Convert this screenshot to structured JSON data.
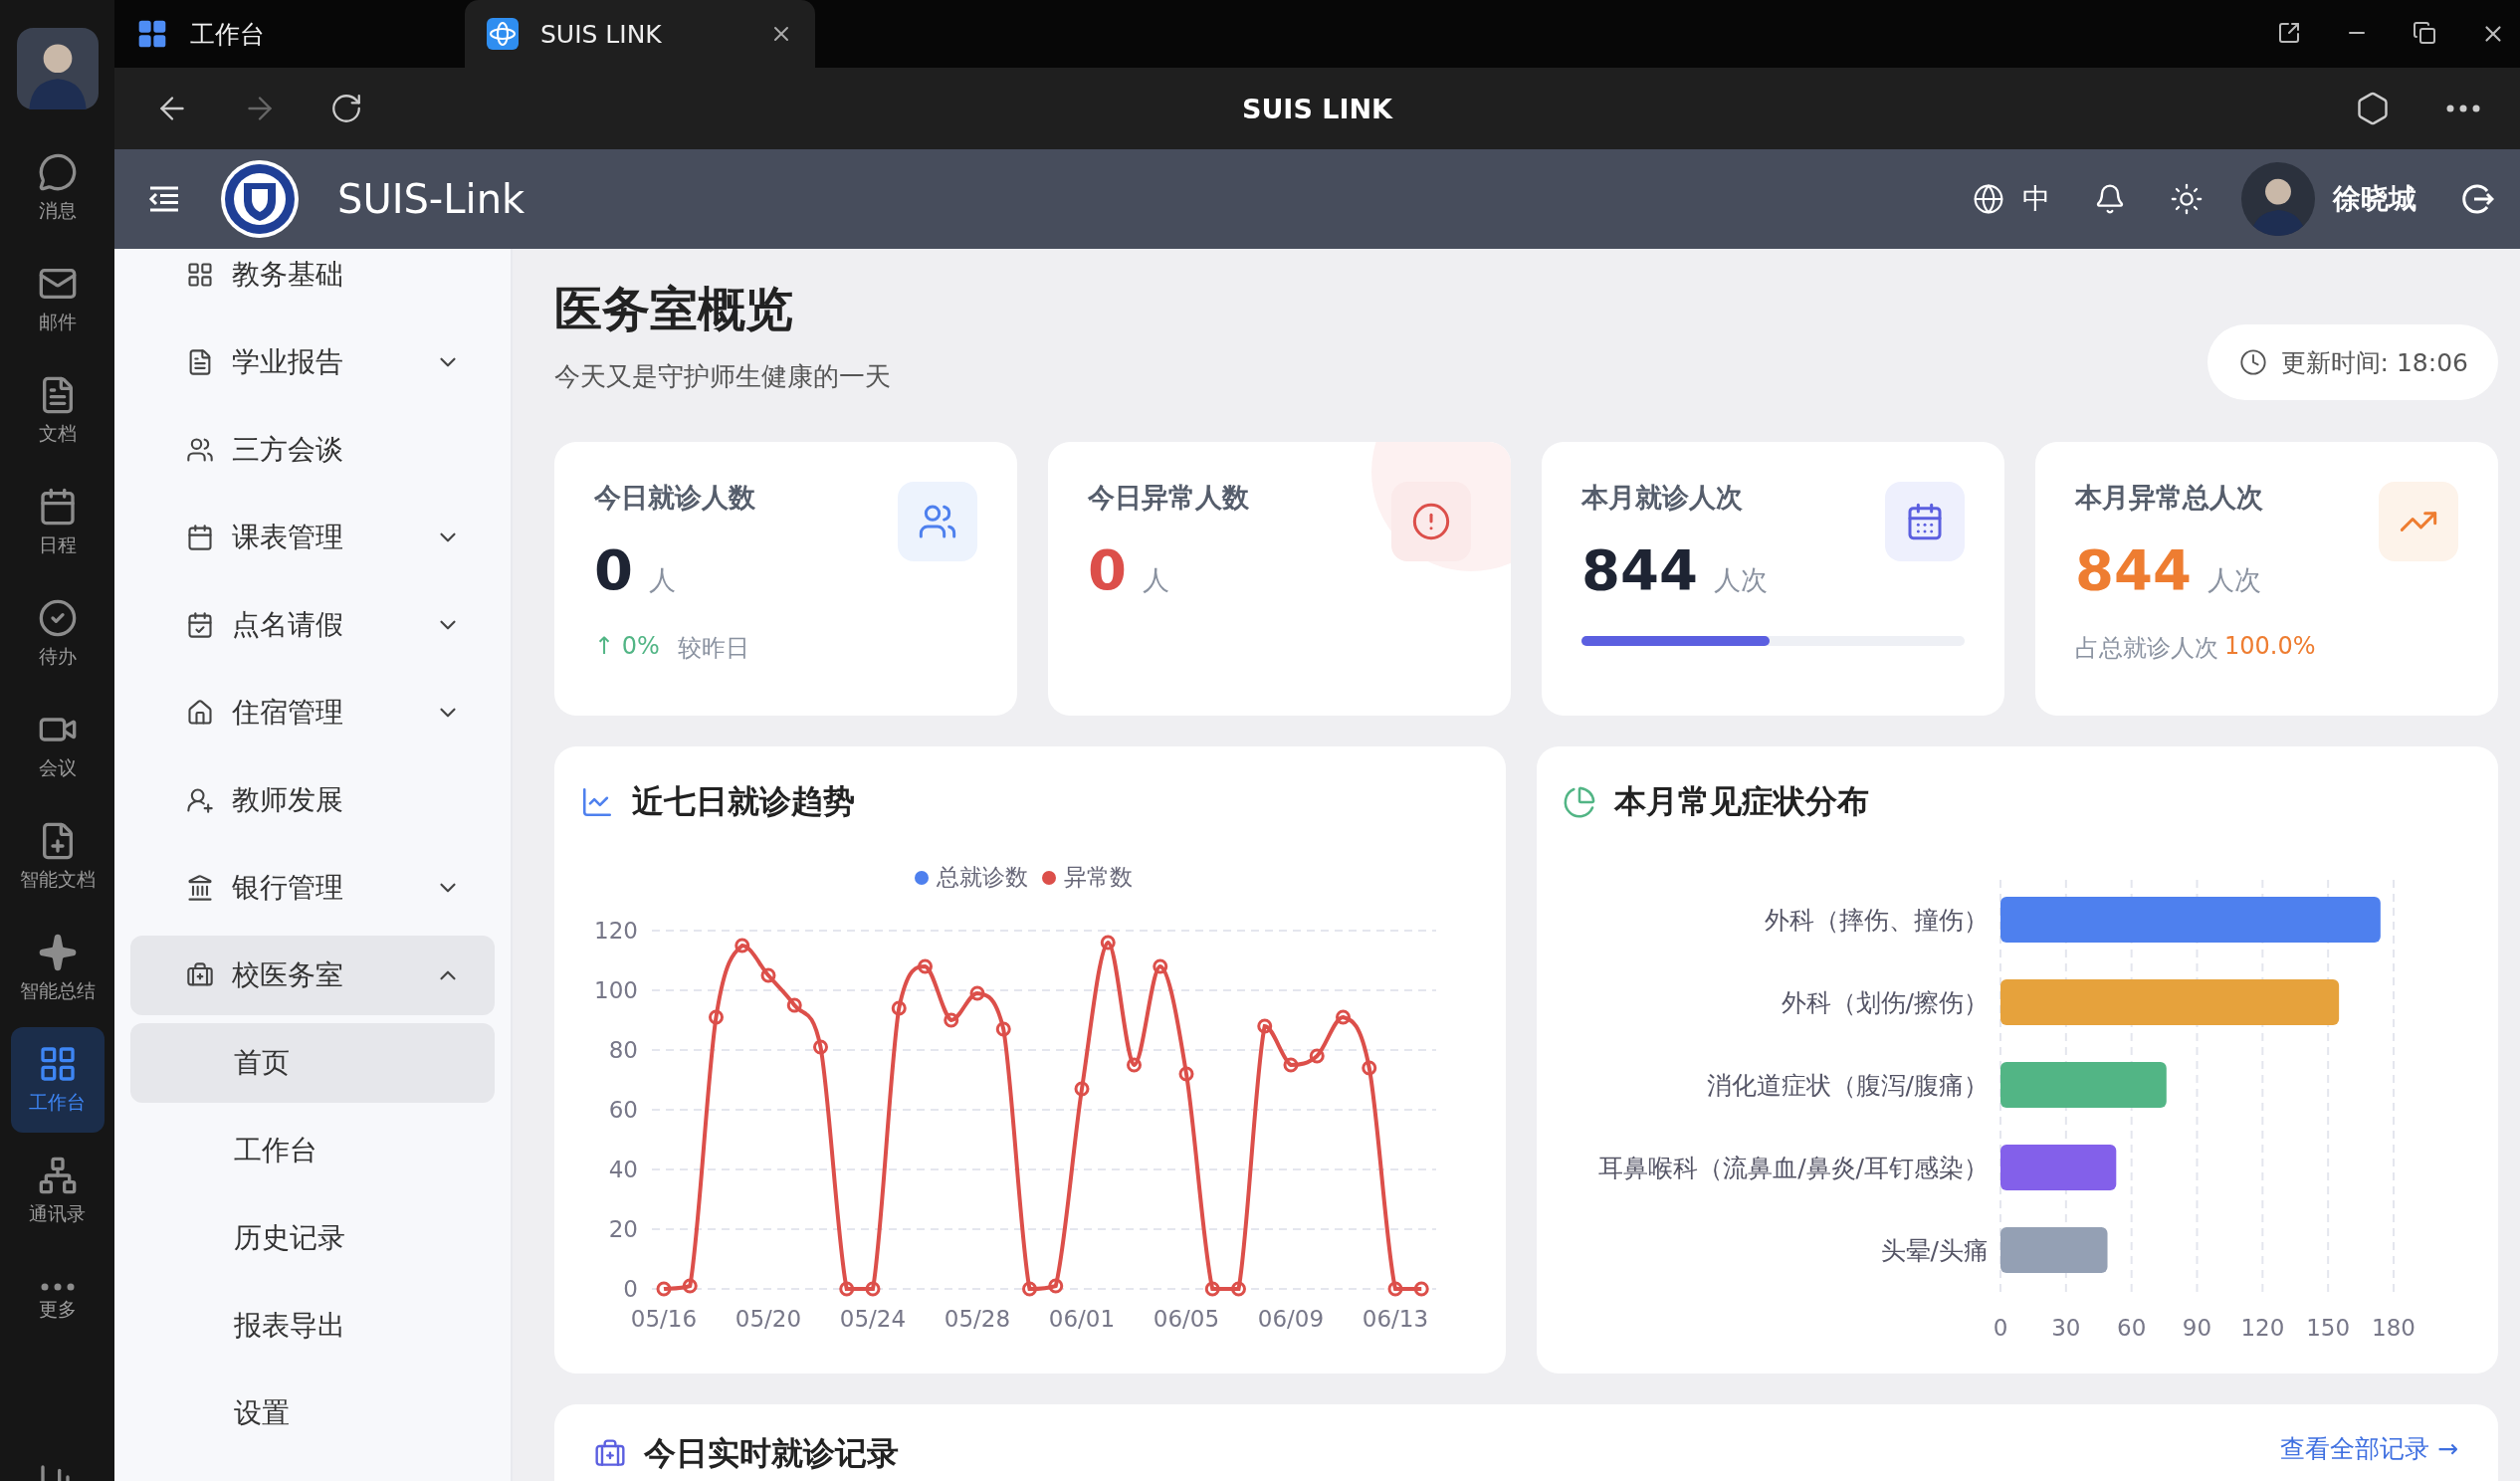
{
  "window_tabs": [
    {
      "label": "工作台",
      "selected": false
    },
    {
      "label": "SUIS LINK",
      "selected": true
    }
  ],
  "browser": {
    "title": "SUIS LINK",
    "forward_disabled": true
  },
  "rail": {
    "items": [
      {
        "label": "消息",
        "selected": false
      },
      {
        "label": "邮件",
        "selected": false
      },
      {
        "label": "文档",
        "selected": false
      },
      {
        "label": "日程",
        "selected": false
      },
      {
        "label": "待办",
        "selected": false
      },
      {
        "label": "会议",
        "selected": false
      },
      {
        "label": "智能文档",
        "selected": false
      },
      {
        "label": "智能总结",
        "selected": false
      },
      {
        "label": "工作台",
        "selected": true
      },
      {
        "label": "通讯录",
        "selected": false
      },
      {
        "label": "更多",
        "selected": false
      }
    ]
  },
  "app_header": {
    "brand": "SUIS-Link",
    "language": "中",
    "user": "徐晓城"
  },
  "sidebar": {
    "items": [
      {
        "label": "教务基础",
        "selected": false
      },
      {
        "label": "学业报告",
        "selected": false,
        "expanded": false
      },
      {
        "label": "三方会谈",
        "selected": false
      },
      {
        "label": "课表管理",
        "selected": false,
        "expanded": false
      },
      {
        "label": "点名请假",
        "selected": false,
        "expanded": false
      },
      {
        "label": "住宿管理",
        "selected": false,
        "expanded": false
      },
      {
        "label": "教师发展",
        "selected": false
      },
      {
        "label": "银行管理",
        "selected": false,
        "expanded": false
      },
      {
        "label": "校医务室",
        "selected": true,
        "expanded": true,
        "children": [
          {
            "label": "首页",
            "selected": true
          },
          {
            "label": "工作台",
            "selected": false
          },
          {
            "label": "历史记录",
            "selected": false
          },
          {
            "label": "报表导出",
            "selected": false
          },
          {
            "label": "设置",
            "selected": false
          }
        ]
      }
    ]
  },
  "page": {
    "title": "医务室概览",
    "subtitle": "今天又是守护师生健康的一天",
    "updated": "更新时间: 18:06"
  },
  "stats": [
    {
      "title": "今日就诊人数",
      "value": "0",
      "unit": "人",
      "footer": {
        "kind": "trend",
        "change": "↑ 0%",
        "text": "较昨日"
      }
    },
    {
      "title": "今日异常人数",
      "value": "0",
      "unit": "人"
    },
    {
      "title": "本月就诊人次",
      "value": "844",
      "unit": "人次",
      "level": 0.49
    },
    {
      "title": "本月异常总人次",
      "value": "844",
      "unit": "人次",
      "footer": {
        "kind": "share",
        "text": "占总就诊人次",
        "change": "100.0%"
      }
    }
  ],
  "trend": {
    "title": "近七日就诊趋势",
    "legend": [
      {
        "label": "总就诊数",
        "color": "#4e80ee"
      }
    ],
    "chart_data": {
      "type": "line",
      "grid": true,
      "categories": [
        "05/16",
        null,
        null,
        null,
        "05/20",
        null,
        null,
        null,
        "05/24",
        null,
        null,
        null,
        "05/28",
        null,
        null,
        null,
        "06/01",
        null,
        null,
        null,
        "06/05",
        null,
        null,
        null,
        "06/09",
        null,
        null,
        null,
        "06/13",
        null
      ],
      "series": [
        {
          "name": "异常数",
          "type": "line",
          "marker": "circle",
          "color": "#dc4f4a",
          "values": [
            0,
            1,
            91,
            115,
            105,
            95,
            81,
            0,
            0,
            94,
            108,
            90,
            99,
            87,
            0,
            1,
            67,
            116,
            75,
            108,
            72,
            0,
            0,
            88,
            75,
            78,
            91,
            74,
            0,
            0
          ]
        }
      ],
      "ylim": [
        0,
        120
      ],
      "yticks": [
        0,
        20,
        40,
        60,
        80,
        100,
        120
      ]
    }
  },
  "symptoms": {
    "title": "本月常见症状分布",
    "chart_data": {
      "type": "bar",
      "orientation": "horizontal",
      "grid": true,
      "categories": [
        "外科（摔伤、撞伤）",
        "外科（划伤/擦伤）",
        "消化道症状（腹泻/腹痛）",
        "耳鼻喉科（流鼻血/鼻炎/耳钉感染）",
        "头晕/头痛"
      ],
      "values": [
        174,
        155,
        76,
        53,
        49
      ],
      "colors": [
        "#4e80ee",
        "#e6a23c",
        "#52b585",
        "#8360ea",
        "#94a0b4"
      ],
      "xlim": [
        0,
        180
      ],
      "xticks": [
        0,
        30,
        60,
        90,
        120,
        150,
        180
      ]
    }
  },
  "records": {
    "title": "今日实时就诊记录",
    "link": "查看全部记录 →"
  }
}
